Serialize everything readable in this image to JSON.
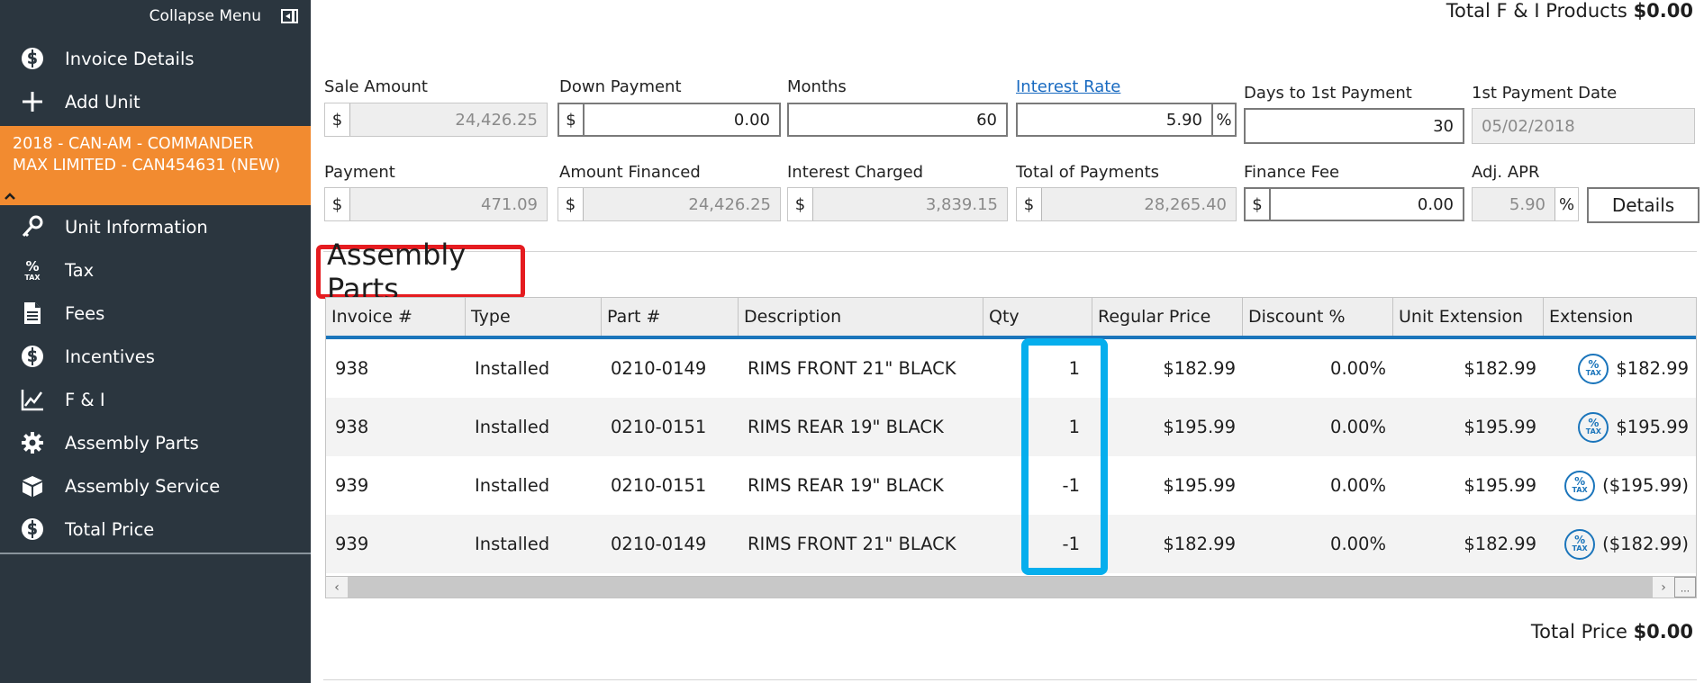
{
  "sidebar": {
    "collapse_label": "Collapse Menu",
    "top_items": [
      {
        "label": "Invoice Details",
        "icon": "dollar-circle-icon"
      },
      {
        "label": "Add Unit",
        "icon": "plus-icon"
      }
    ],
    "unit": {
      "line1": "2018 - CAN-AM - COMMANDER",
      "line2": "MAX LIMITED - CAN454631 (NEW)"
    },
    "items": [
      {
        "label": "Unit Information",
        "icon": "key-icon"
      },
      {
        "label": "Tax",
        "icon": "percent-tax-icon"
      },
      {
        "label": "Fees",
        "icon": "document-icon"
      },
      {
        "label": "Incentives",
        "icon": "dollar-circle-icon"
      },
      {
        "label": "F & I",
        "icon": "line-chart-icon"
      },
      {
        "label": "Assembly Parts",
        "icon": "gear-icon"
      },
      {
        "label": "Assembly Service",
        "icon": "box-icon"
      },
      {
        "label": "Total Price",
        "icon": "dollar-circle-icon"
      }
    ]
  },
  "totals": {
    "fi_label": "Total F & I Products",
    "fi_value": "$0.00",
    "price_label": "Total Price",
    "price_value": "$0.00"
  },
  "finance": {
    "currency": "$",
    "percent": "%",
    "sale_amount": {
      "label": "Sale Amount",
      "value": "24,426.25"
    },
    "down_payment": {
      "label": "Down Payment",
      "value": "0.00"
    },
    "months": {
      "label": "Months",
      "value": "60"
    },
    "interest_rate": {
      "label": "Interest Rate",
      "value": "5.90"
    },
    "days_to_first": {
      "label": "Days to 1st Payment",
      "value": "30"
    },
    "first_payment_date": {
      "label": "1st Payment Date",
      "value": "05/02/2018"
    },
    "payment": {
      "label": "Payment",
      "value": "471.09"
    },
    "amount_financed": {
      "label": "Amount Financed",
      "value": "24,426.25"
    },
    "interest_charged": {
      "label": "Interest Charged",
      "value": "3,839.15"
    },
    "total_payments": {
      "label": "Total of Payments",
      "value": "28,265.40"
    },
    "finance_fee": {
      "label": "Finance Fee",
      "value": "0.00"
    },
    "adj_apr": {
      "label": "Adj. APR",
      "value": "5.90"
    },
    "details_label": "Details"
  },
  "assembly": {
    "title": "Assembly Parts",
    "columns": [
      "Invoice #",
      "Type",
      "Part #",
      "Description",
      "Qty",
      "Regular Price",
      "Discount %",
      "Unit Extension",
      "Extension"
    ],
    "rows": [
      {
        "invoice": "938",
        "type": "Installed",
        "part": "0210-0149",
        "desc": "RIMS FRONT 21\" BLACK",
        "qty": "1",
        "price": "$182.99",
        "discount": "0.00%",
        "unit_ext": "$182.99",
        "ext": "$182.99"
      },
      {
        "invoice": "938",
        "type": "Installed",
        "part": "0210-0151",
        "desc": "RIMS REAR 19\" BLACK",
        "qty": "1",
        "price": "$195.99",
        "discount": "0.00%",
        "unit_ext": "$195.99",
        "ext": "$195.99"
      },
      {
        "invoice": "939",
        "type": "Installed",
        "part": "0210-0151",
        "desc": "RIMS REAR 19\" BLACK",
        "qty": "-1",
        "price": "$195.99",
        "discount": "0.00%",
        "unit_ext": "$195.99",
        "ext": "($195.99)"
      },
      {
        "invoice": "939",
        "type": "Installed",
        "part": "0210-0149",
        "desc": "RIMS FRONT 21\" BLACK",
        "qty": "-1",
        "price": "$182.99",
        "discount": "0.00%",
        "unit_ext": "$182.99",
        "ext": "($182.99)"
      }
    ],
    "tax_icon": {
      "symbol": "%",
      "text": "TAX"
    }
  },
  "colors": {
    "sidebar_bg": "#2b363f",
    "unit_orange": "#f28b30",
    "accent_blue": "#1b75bb",
    "highlight_red": "#e51c20",
    "highlight_cyan": "#05aeed"
  }
}
